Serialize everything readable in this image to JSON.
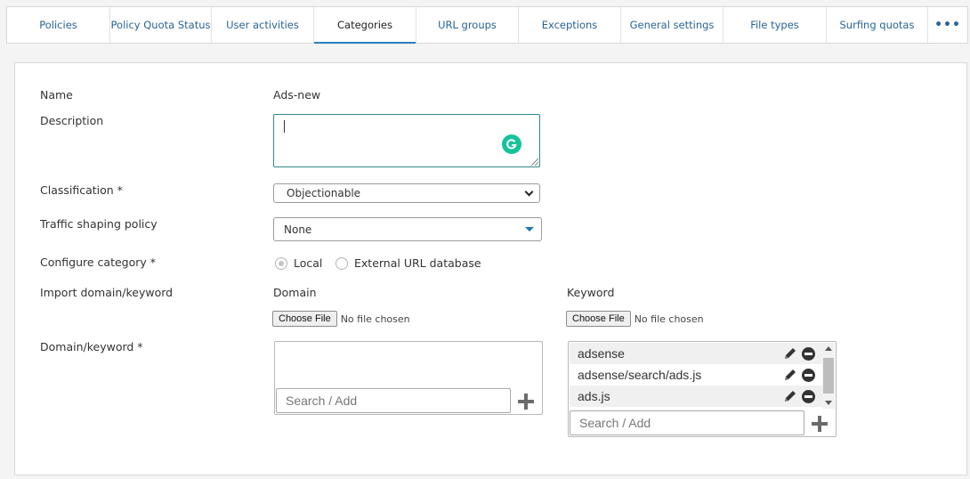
{
  "tabs": [
    {
      "label": "Policies",
      "name": "tab-policies"
    },
    {
      "label": "Policy Quota Status",
      "name": "tab-policy-quota-status"
    },
    {
      "label": "User activities",
      "name": "tab-user-activities"
    },
    {
      "label": "Categories",
      "name": "tab-categories",
      "active": true
    },
    {
      "label": "URL groups",
      "name": "tab-url-groups"
    },
    {
      "label": "Exceptions",
      "name": "tab-exceptions"
    },
    {
      "label": "General settings",
      "name": "tab-general-settings"
    },
    {
      "label": "File types",
      "name": "tab-file-types"
    },
    {
      "label": "Surfing quotas",
      "name": "tab-surfing-quotas"
    },
    {
      "label": "•••",
      "name": "tab-more"
    }
  ],
  "form": {
    "name_label": "Name",
    "name_value": "Ads-new",
    "description_label": "Description",
    "description_value": "",
    "classification_label": "Classification *",
    "classification_value": "Objectionable",
    "traffic_label": "Traffic shaping policy",
    "traffic_value": "None",
    "configure_label": "Configure category *",
    "configure_options": [
      "Local",
      "External URL database"
    ],
    "configure_selected": "Local",
    "import_label": "Import domain/keyword",
    "domain_heading": "Domain",
    "keyword_heading": "Keyword",
    "choose_file": "Choose File",
    "no_file": "No file chosen",
    "domain_keyword_label": "Domain/keyword *",
    "search_placeholder": "Search / Add",
    "domains": [],
    "keywords": [
      "adsense",
      "adsense/search/ads.js",
      "ads.js"
    ]
  },
  "icons": {
    "grammarly": "grammarly-icon",
    "edit": "pencil-icon",
    "remove": "minus-circle-icon",
    "add": "plus-icon"
  },
  "colors": {
    "link": "#2a6496",
    "active_underline": "#2a80b9",
    "focus_border": "#2e8b8b",
    "grammarly": "#15c39a"
  }
}
